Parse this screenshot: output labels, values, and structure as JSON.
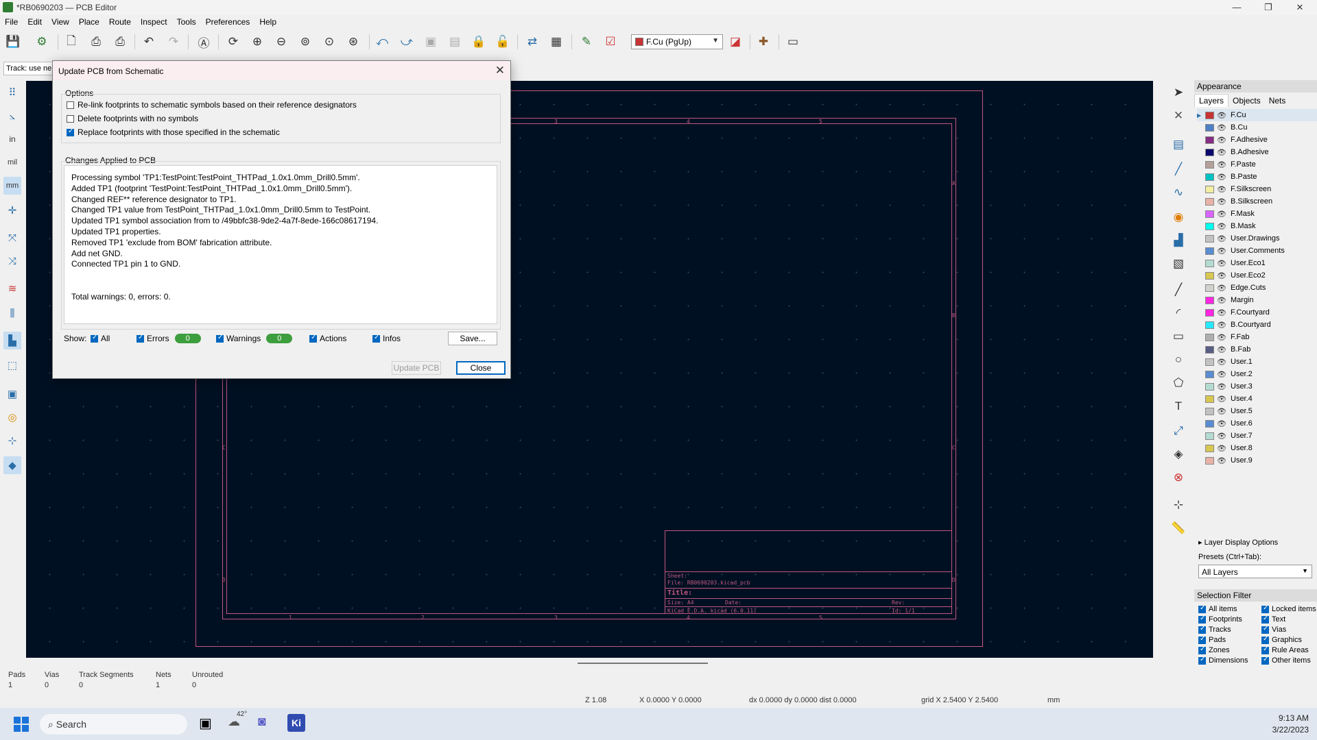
{
  "window": {
    "title": "*RB0690203 — PCB Editor"
  },
  "menu": [
    "File",
    "Edit",
    "View",
    "Place",
    "Route",
    "Inspect",
    "Tools",
    "Preferences",
    "Help"
  ],
  "toolbar": {
    "layer_selector": "F.Cu (PgUp)",
    "icons": [
      "save-icon",
      "board-setup-icon",
      "page-settings-icon",
      "print-icon",
      "plot-icon",
      "undo-icon",
      "redo-icon",
      "find-icon",
      "refresh-icon",
      "zoom-in-icon",
      "zoom-out-icon",
      "zoom-fit-icon",
      "zoom-objects-icon",
      "zoom-selection-icon",
      "rotate-ccw-icon",
      "rotate-cw-icon",
      "group-icon",
      "ungroup-icon",
      "lock-icon",
      "unlock-icon",
      "update-pcb-icon",
      "footprint-editor-icon",
      "scripting-icon",
      "drc-icon",
      "layer-pair-icon",
      "interactive-router-icon",
      "console-icon"
    ]
  },
  "hint_field": "Track: use ne",
  "dialog": {
    "title": "Update PCB from Schematic",
    "options_label": "Options",
    "options": [
      {
        "label": "Re-link footprints to schematic symbols based on their reference designators",
        "checked": false
      },
      {
        "label": "Delete footprints with no symbols",
        "checked": false
      },
      {
        "label": "Replace footprints with those specified in the schematic",
        "checked": true
      }
    ],
    "changes_label": "Changes Applied to PCB",
    "log": [
      "Processing symbol 'TP1:TestPoint:TestPoint_THTPad_1.0x1.0mm_Drill0.5mm'.",
      "Added TP1 (footprint 'TestPoint:TestPoint_THTPad_1.0x1.0mm_Drill0.5mm').",
      "Changed REF** reference designator to TP1.",
      "Changed TP1 value from TestPoint_THTPad_1.0x1.0mm_Drill0.5mm to TestPoint.",
      "Updated TP1 symbol association from  to /49bbfc38-9de2-4a7f-8ede-166c08617194.",
      "Updated TP1 properties.",
      "Removed TP1 'exclude from BOM' fabrication attribute.",
      "Add net GND.",
      "Connected TP1 pin 1 to GND.",
      "",
      "",
      "Total warnings: 0, errors: 0."
    ],
    "show_label": "Show:",
    "filters": {
      "all": "All",
      "errors": "Errors",
      "errors_count": "0",
      "warnings": "Warnings",
      "warnings_count": "0",
      "actions": "Actions",
      "infos": "Infos"
    },
    "save_button": "Save...",
    "update_button": "Update PCB",
    "close_button": "Close"
  },
  "sheet": {
    "col_marks": [
      "1",
      "2",
      "3",
      "4",
      "5"
    ],
    "row_marks": [
      "A",
      "B",
      "C",
      "D"
    ],
    "title_block": {
      "sheet": "Sheet:",
      "file": "File: RB0690203.kicad_pcb",
      "title": "Title:",
      "size": "Size: A4",
      "date": "Date:",
      "rev": "Rev:",
      "tool": "KiCad E.D.A.  kicad (6.0.11)",
      "id": "Id: 1/1"
    }
  },
  "appearance": {
    "header": "Appearance",
    "tabs": [
      "Layers",
      "Objects",
      "Nets"
    ],
    "layers": [
      {
        "name": "F.Cu",
        "color": "#c83434"
      },
      {
        "name": "B.Cu",
        "color": "#4d7fc4"
      },
      {
        "name": "F.Adhesive",
        "color": "#842d84"
      },
      {
        "name": "B.Adhesive",
        "color": "#0a0a6e"
      },
      {
        "name": "F.Paste",
        "color": "#b4a09b"
      },
      {
        "name": "B.Paste",
        "color": "#00c2c2"
      },
      {
        "name": "F.Silkscreen",
        "color": "#f2eda1"
      },
      {
        "name": "B.Silkscreen",
        "color": "#e8b2a7"
      },
      {
        "name": "F.Mask",
        "color": "#d864ff"
      },
      {
        "name": "B.Mask",
        "color": "#02ffee"
      },
      {
        "name": "User.Drawings",
        "color": "#c2c2c2"
      },
      {
        "name": "User.Comments",
        "color": "#598dd1"
      },
      {
        "name": "User.Eco1",
        "color": "#b4dbd2"
      },
      {
        "name": "User.Eco2",
        "color": "#d8c852"
      },
      {
        "name": "Edge.Cuts",
        "color": "#d0d2cd"
      },
      {
        "name": "Margin",
        "color": "#ff26e2"
      },
      {
        "name": "F.Courtyard",
        "color": "#ff26e2"
      },
      {
        "name": "B.Courtyard",
        "color": "#26e9ff"
      },
      {
        "name": "F.Fab",
        "color": "#afafaf"
      },
      {
        "name": "B.Fab",
        "color": "#585d84"
      },
      {
        "name": "User.1",
        "color": "#c2c2c2"
      },
      {
        "name": "User.2",
        "color": "#598dd1"
      },
      {
        "name": "User.3",
        "color": "#b4dbd2"
      },
      {
        "name": "User.4",
        "color": "#d8c852"
      },
      {
        "name": "User.5",
        "color": "#c2c2c2"
      },
      {
        "name": "User.6",
        "color": "#598dd1"
      },
      {
        "name": "User.7",
        "color": "#b4dbd2"
      },
      {
        "name": "User.8",
        "color": "#d8c852"
      },
      {
        "name": "User.9",
        "color": "#e8b2a7"
      }
    ],
    "layer_display_options": "Layer Display Options",
    "presets_label": "Presets (Ctrl+Tab):",
    "presets_value": "All Layers",
    "selection_filter_label": "Selection Filter",
    "selection_filter": [
      [
        "All items",
        "Locked items"
      ],
      [
        "Footprints",
        "Text"
      ],
      [
        "Tracks",
        "Vias"
      ],
      [
        "Pads",
        "Graphics"
      ],
      [
        "Zones",
        "Rule Areas"
      ],
      [
        "Dimensions",
        "Other items"
      ]
    ]
  },
  "message_panel": {
    "items": [
      {
        "label": "Pads",
        "value": "1"
      },
      {
        "label": "Vias",
        "value": "0"
      },
      {
        "label": "Track Segments",
        "value": "0"
      },
      {
        "label": "Nets",
        "value": "1"
      },
      {
        "label": "Unrouted",
        "value": "0"
      }
    ]
  },
  "statusbar": {
    "zoom": "Z 1.08",
    "xy": "X 0.0000  Y 0.0000",
    "dxy": "dx 0.0000  dy 0.0000  dist 0.0000",
    "grid": "grid X 2.5400  Y 2.5400",
    "units": "mm"
  },
  "taskbar": {
    "search": "Search",
    "weather": "42°",
    "time": "9:13 AM",
    "date": "3/22/2023"
  }
}
